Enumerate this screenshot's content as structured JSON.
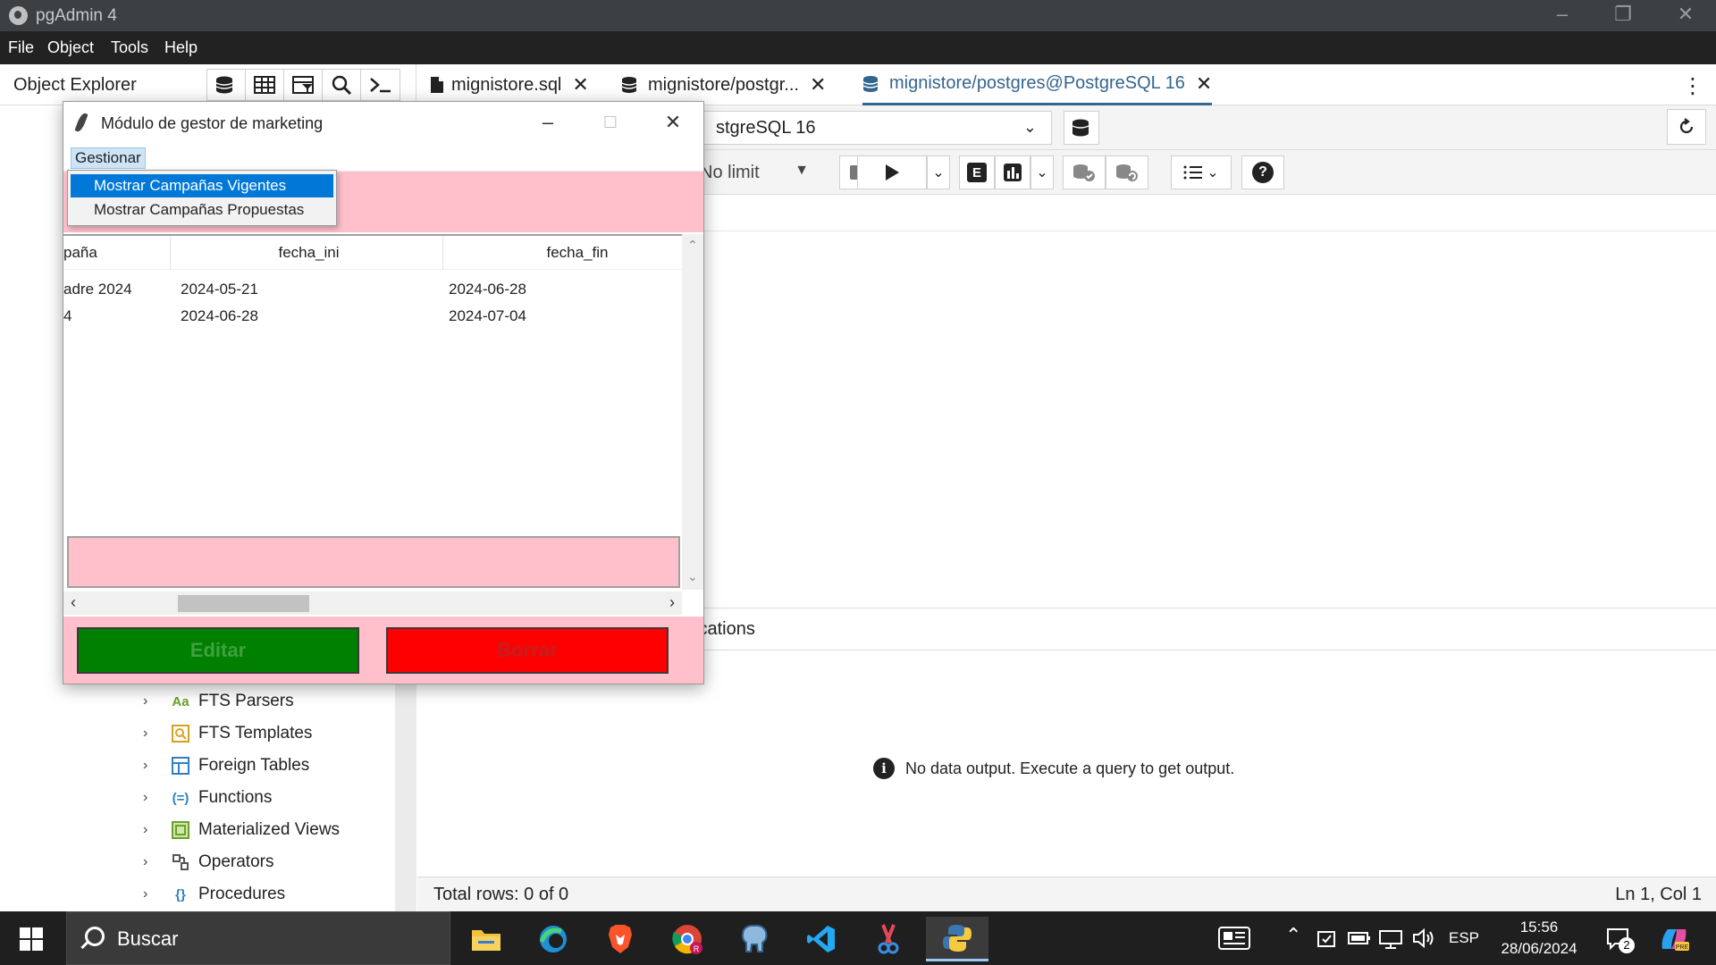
{
  "window": {
    "title": "pgAdmin 4",
    "controls": [
      "minimize",
      "restore",
      "close"
    ]
  },
  "menubar": {
    "items": [
      "File",
      "Object",
      "Tools",
      "Help"
    ]
  },
  "explorer": {
    "title": "Object Explorer",
    "tree_items": [
      {
        "label": "FTS Parsers",
        "icon_text": "Aa"
      },
      {
        "label": "FTS Templates"
      },
      {
        "label": "Foreign Tables"
      },
      {
        "label": "Functions",
        "icon_text": "(=)"
      },
      {
        "label": "Materialized Views"
      },
      {
        "label": "Operators"
      },
      {
        "label": "Procedures",
        "icon_text": "{}"
      }
    ]
  },
  "query_tool": {
    "tabs": [
      {
        "label": "mignistore.sql",
        "active": false
      },
      {
        "label": "mignistore/postgr...",
        "active": false
      },
      {
        "label": "mignistore/postgres@PostgreSQL 16",
        "active": true
      }
    ],
    "connection": "stgreSQL 16",
    "limit": "No limit",
    "explain_label": "E",
    "result_tab_partial": "ifications",
    "no_data_message": "No data output. Execute a query to get output.",
    "status_left": "Total rows: 0 of 0",
    "status_right": "Ln 1, Col 1"
  },
  "dialog": {
    "title": "Módulo de gestor de marketing",
    "menu_label": "Gestionar",
    "menu_options": [
      {
        "label": "Mostrar Campañas Vigentes",
        "selected": true
      },
      {
        "label": "Mostrar Campañas Propuestas",
        "selected": false
      }
    ],
    "columns": [
      "paña",
      "fecha_ini",
      "fecha_fin"
    ],
    "rows": [
      [
        "adre 2024",
        "2024-05-21",
        "2024-06-28"
      ],
      [
        "4",
        "2024-06-28",
        "2024-07-04"
      ]
    ],
    "edit_label": "Editar",
    "delete_label": "Borrar",
    "colors": {
      "pink": "#ffc0cb",
      "edit_bg": "#008000",
      "delete_bg": "#ff0000"
    }
  },
  "taskbar": {
    "search_placeholder": "Buscar",
    "language": "ESP",
    "time": "15:56",
    "date": "28/06/2024",
    "notification_count": "2",
    "apps": [
      "file-explorer-icon",
      "edge-icon",
      "brave-icon",
      "chrome-icon",
      "pgadmin-elephant-icon",
      "vscode-icon",
      "snipping-tool-icon",
      "python-icon"
    ]
  }
}
